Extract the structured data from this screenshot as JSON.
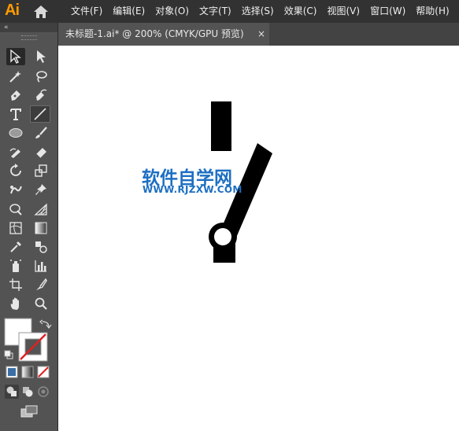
{
  "app": {
    "logo_text": "Ai"
  },
  "menus": [
    {
      "label": "文件(F)"
    },
    {
      "label": "编辑(E)"
    },
    {
      "label": "对象(O)"
    },
    {
      "label": "文字(T)"
    },
    {
      "label": "选择(S)"
    },
    {
      "label": "效果(C)"
    },
    {
      "label": "视图(V)"
    },
    {
      "label": "窗口(W)"
    },
    {
      "label": "帮助(H)"
    }
  ],
  "document_tab": {
    "title": "未标题-1.ai* @ 200% (CMYK/GPU 预览)",
    "close_glyph": "×"
  },
  "toolbar": {
    "collapse_glyph": "«"
  },
  "watermark": {
    "title": "软件自学网",
    "url": "WWW.RJZXW.COM"
  },
  "colors": {
    "accent_logo": "#ff9a00",
    "watermark": "#1d6fc2",
    "stroke_none": "#e02020"
  }
}
